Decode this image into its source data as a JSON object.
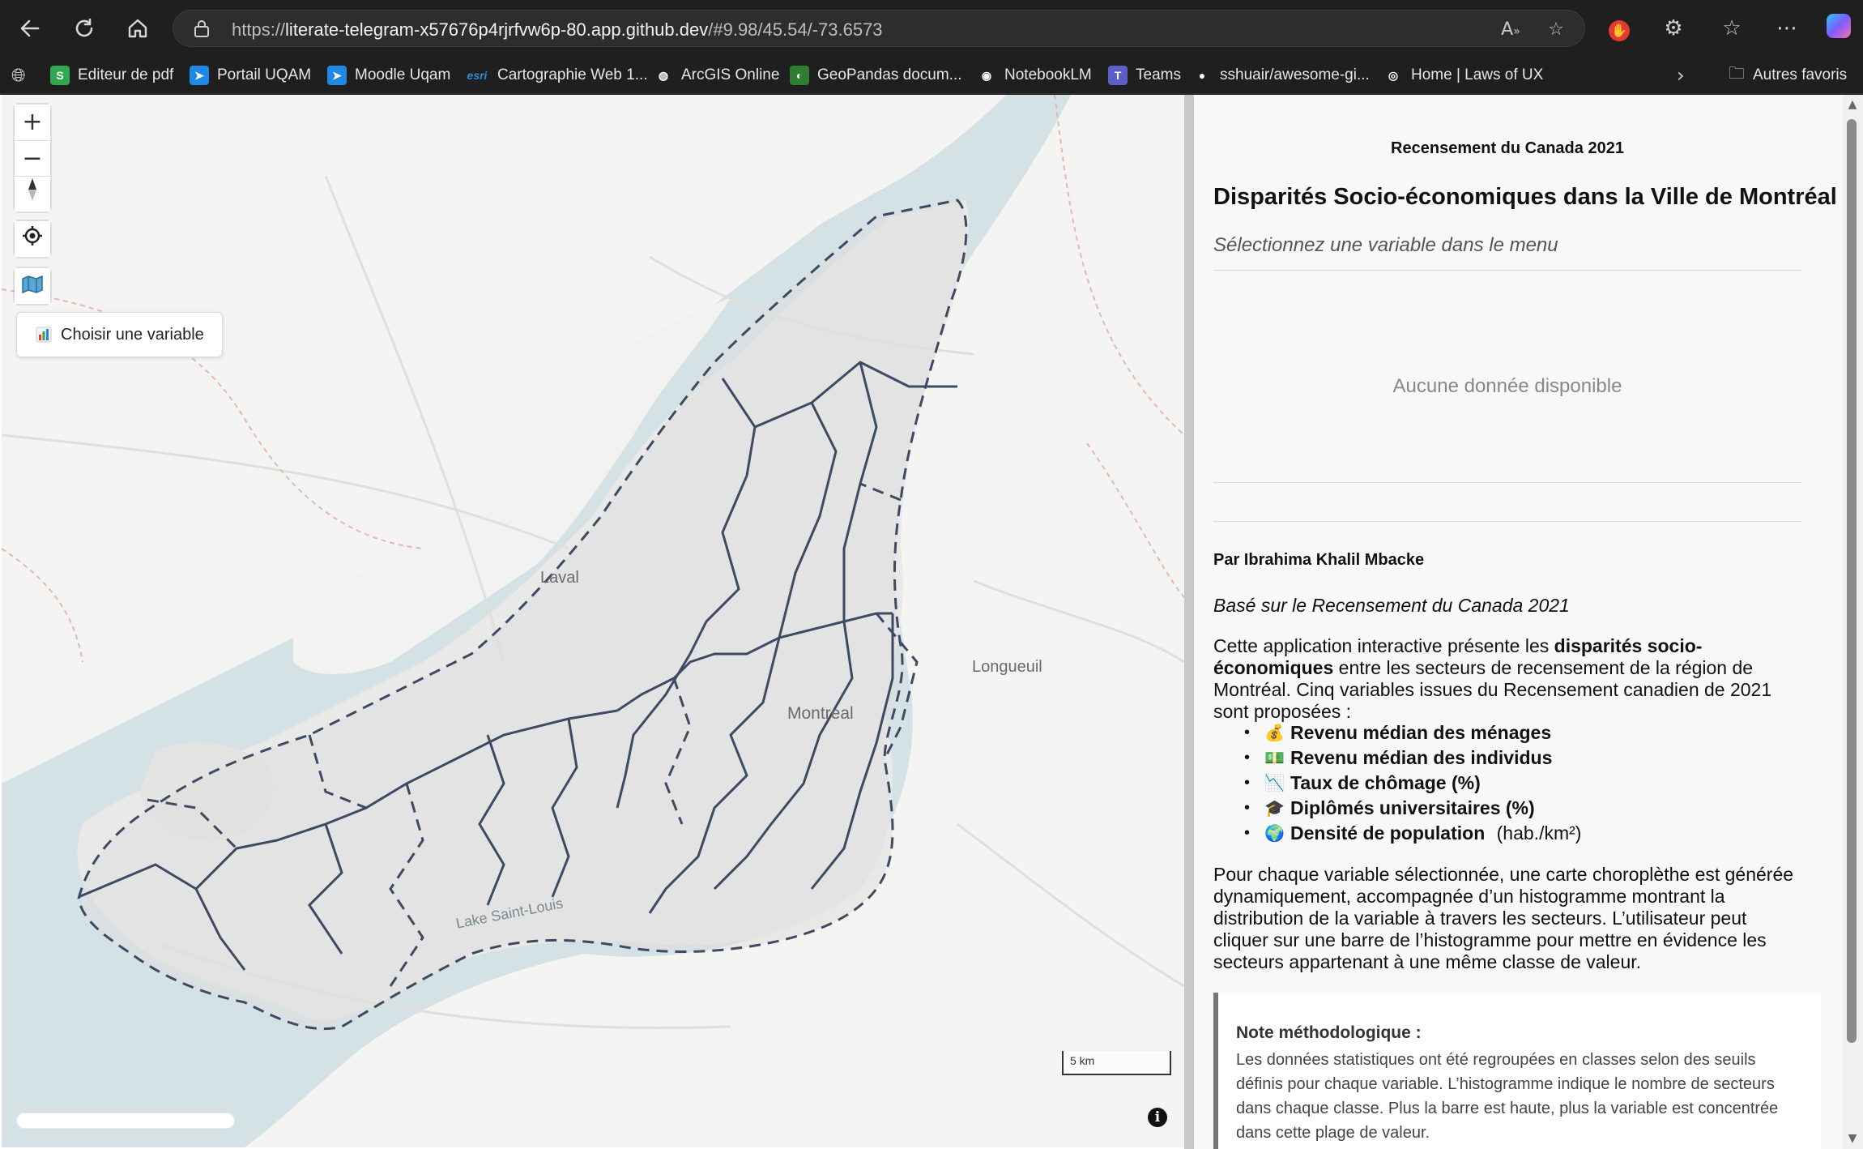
{
  "browser": {
    "url_prefix": "https://",
    "url_host": "literate-telegram-x57676p4rjrfvw6p-80.app.github.dev",
    "url_path": "/#9.98/45.54/-73.6573",
    "bookmarks": [
      {
        "label": "Editeur de pdf",
        "icon": "pdf-editor-icon",
        "color": "#2fa84f",
        "glyph": "S"
      },
      {
        "label": "Portail UQAM",
        "icon": "uqam-icon",
        "color": "#1e88e5",
        "glyph": "➤"
      },
      {
        "label": "Moodle Uqam",
        "icon": "moodle-icon",
        "color": "#1e88e5",
        "glyph": "➤"
      },
      {
        "label": "Cartographie Web 1...",
        "icon": "esri-icon",
        "color": "#1f1f1f",
        "glyph": "esri"
      },
      {
        "label": "ArcGIS Online",
        "icon": "globe-icon",
        "color": "#1f1f1f",
        "glyph": "◍"
      },
      {
        "label": "GeoPandas docum...",
        "icon": "geopandas-icon",
        "color": "#2e7d32",
        "glyph": "◐"
      },
      {
        "label": "NotebookLM",
        "icon": "notebooklm-icon",
        "color": "#1f1f1f",
        "glyph": "◉"
      },
      {
        "label": "Teams",
        "icon": "teams-icon",
        "color": "#5b5fc7",
        "glyph": "T"
      },
      {
        "label": "sshuair/awesome-gi...",
        "icon": "github-icon",
        "color": "#1f1f1f",
        "glyph": "●"
      },
      {
        "label": "Home | Laws of UX",
        "icon": "lawsofux-icon",
        "color": "#1f1f1f",
        "glyph": "◎"
      }
    ],
    "other_favorites": "Autres favoris"
  },
  "map": {
    "choose_variable": "Choisir une variable",
    "labels": {
      "laval": "Laval",
      "longueuil": "Longueuil",
      "montreal": "Montreal",
      "lake": "Lake Saint-Louis"
    },
    "scale": "5 km",
    "info": "i",
    "colors": {
      "water": "#d4e2e6",
      "land": "#f4f4f2",
      "island": "#e8e8e8",
      "boundary": "#3d4a63"
    }
  },
  "panel": {
    "census_label": "Recensement du Canada 2021",
    "title": "Disparités Socio-économiques dans la Ville de Montréal",
    "subtitle": "Sélectionnez une variable dans le menu",
    "no_data": "Aucune donnée disponible",
    "author": "Par Ibrahima Khalil Mbacke",
    "based_on": "Basé sur le Recensement du Canada 2021",
    "intro_before": "Cette application interactive présente les ",
    "intro_bold": "disparités socio-économiques",
    "intro_after": " entre les secteurs de recensement de la région de Montréal. Cinq variables issues du Recensement canadien de 2021 sont proposées :",
    "variables": [
      {
        "emoji": "💰",
        "icon": "money-bag-icon",
        "label": "Revenu médian des ménages",
        "suffix": ""
      },
      {
        "emoji": "💵",
        "icon": "banknote-icon",
        "label": "Revenu médian des individus",
        "suffix": ""
      },
      {
        "emoji": "📉",
        "icon": "chart-down-icon",
        "label": "Taux de chômage (%)",
        "suffix": ""
      },
      {
        "emoji": "🎓",
        "icon": "graduation-cap-icon",
        "label": "Diplômés universitaires (%)",
        "suffix": ""
      },
      {
        "emoji": "🌍",
        "icon": "globe-icon",
        "label": "Densité de population",
        "suffix": " (hab./km²)"
      }
    ],
    "description": "Pour chaque variable sélectionnée, une carte choroplèthe est générée dynamiquement, accompagnée d’un histogramme montrant la distribution de la variable à travers les secteurs. L’utilisateur peut cliquer sur une barre de l’histogramme pour mettre en évidence les secteurs appartenant à une même classe de valeur.",
    "note_title": "Note méthodologique :",
    "note_body": "Les données statistiques ont été regroupées en classes selon des seuils définis pour chaque variable. L’histogramme indique le nombre de secteurs dans chaque classe. Plus la barre est haute, plus la variable est concentrée dans cette plage de valeur."
  }
}
